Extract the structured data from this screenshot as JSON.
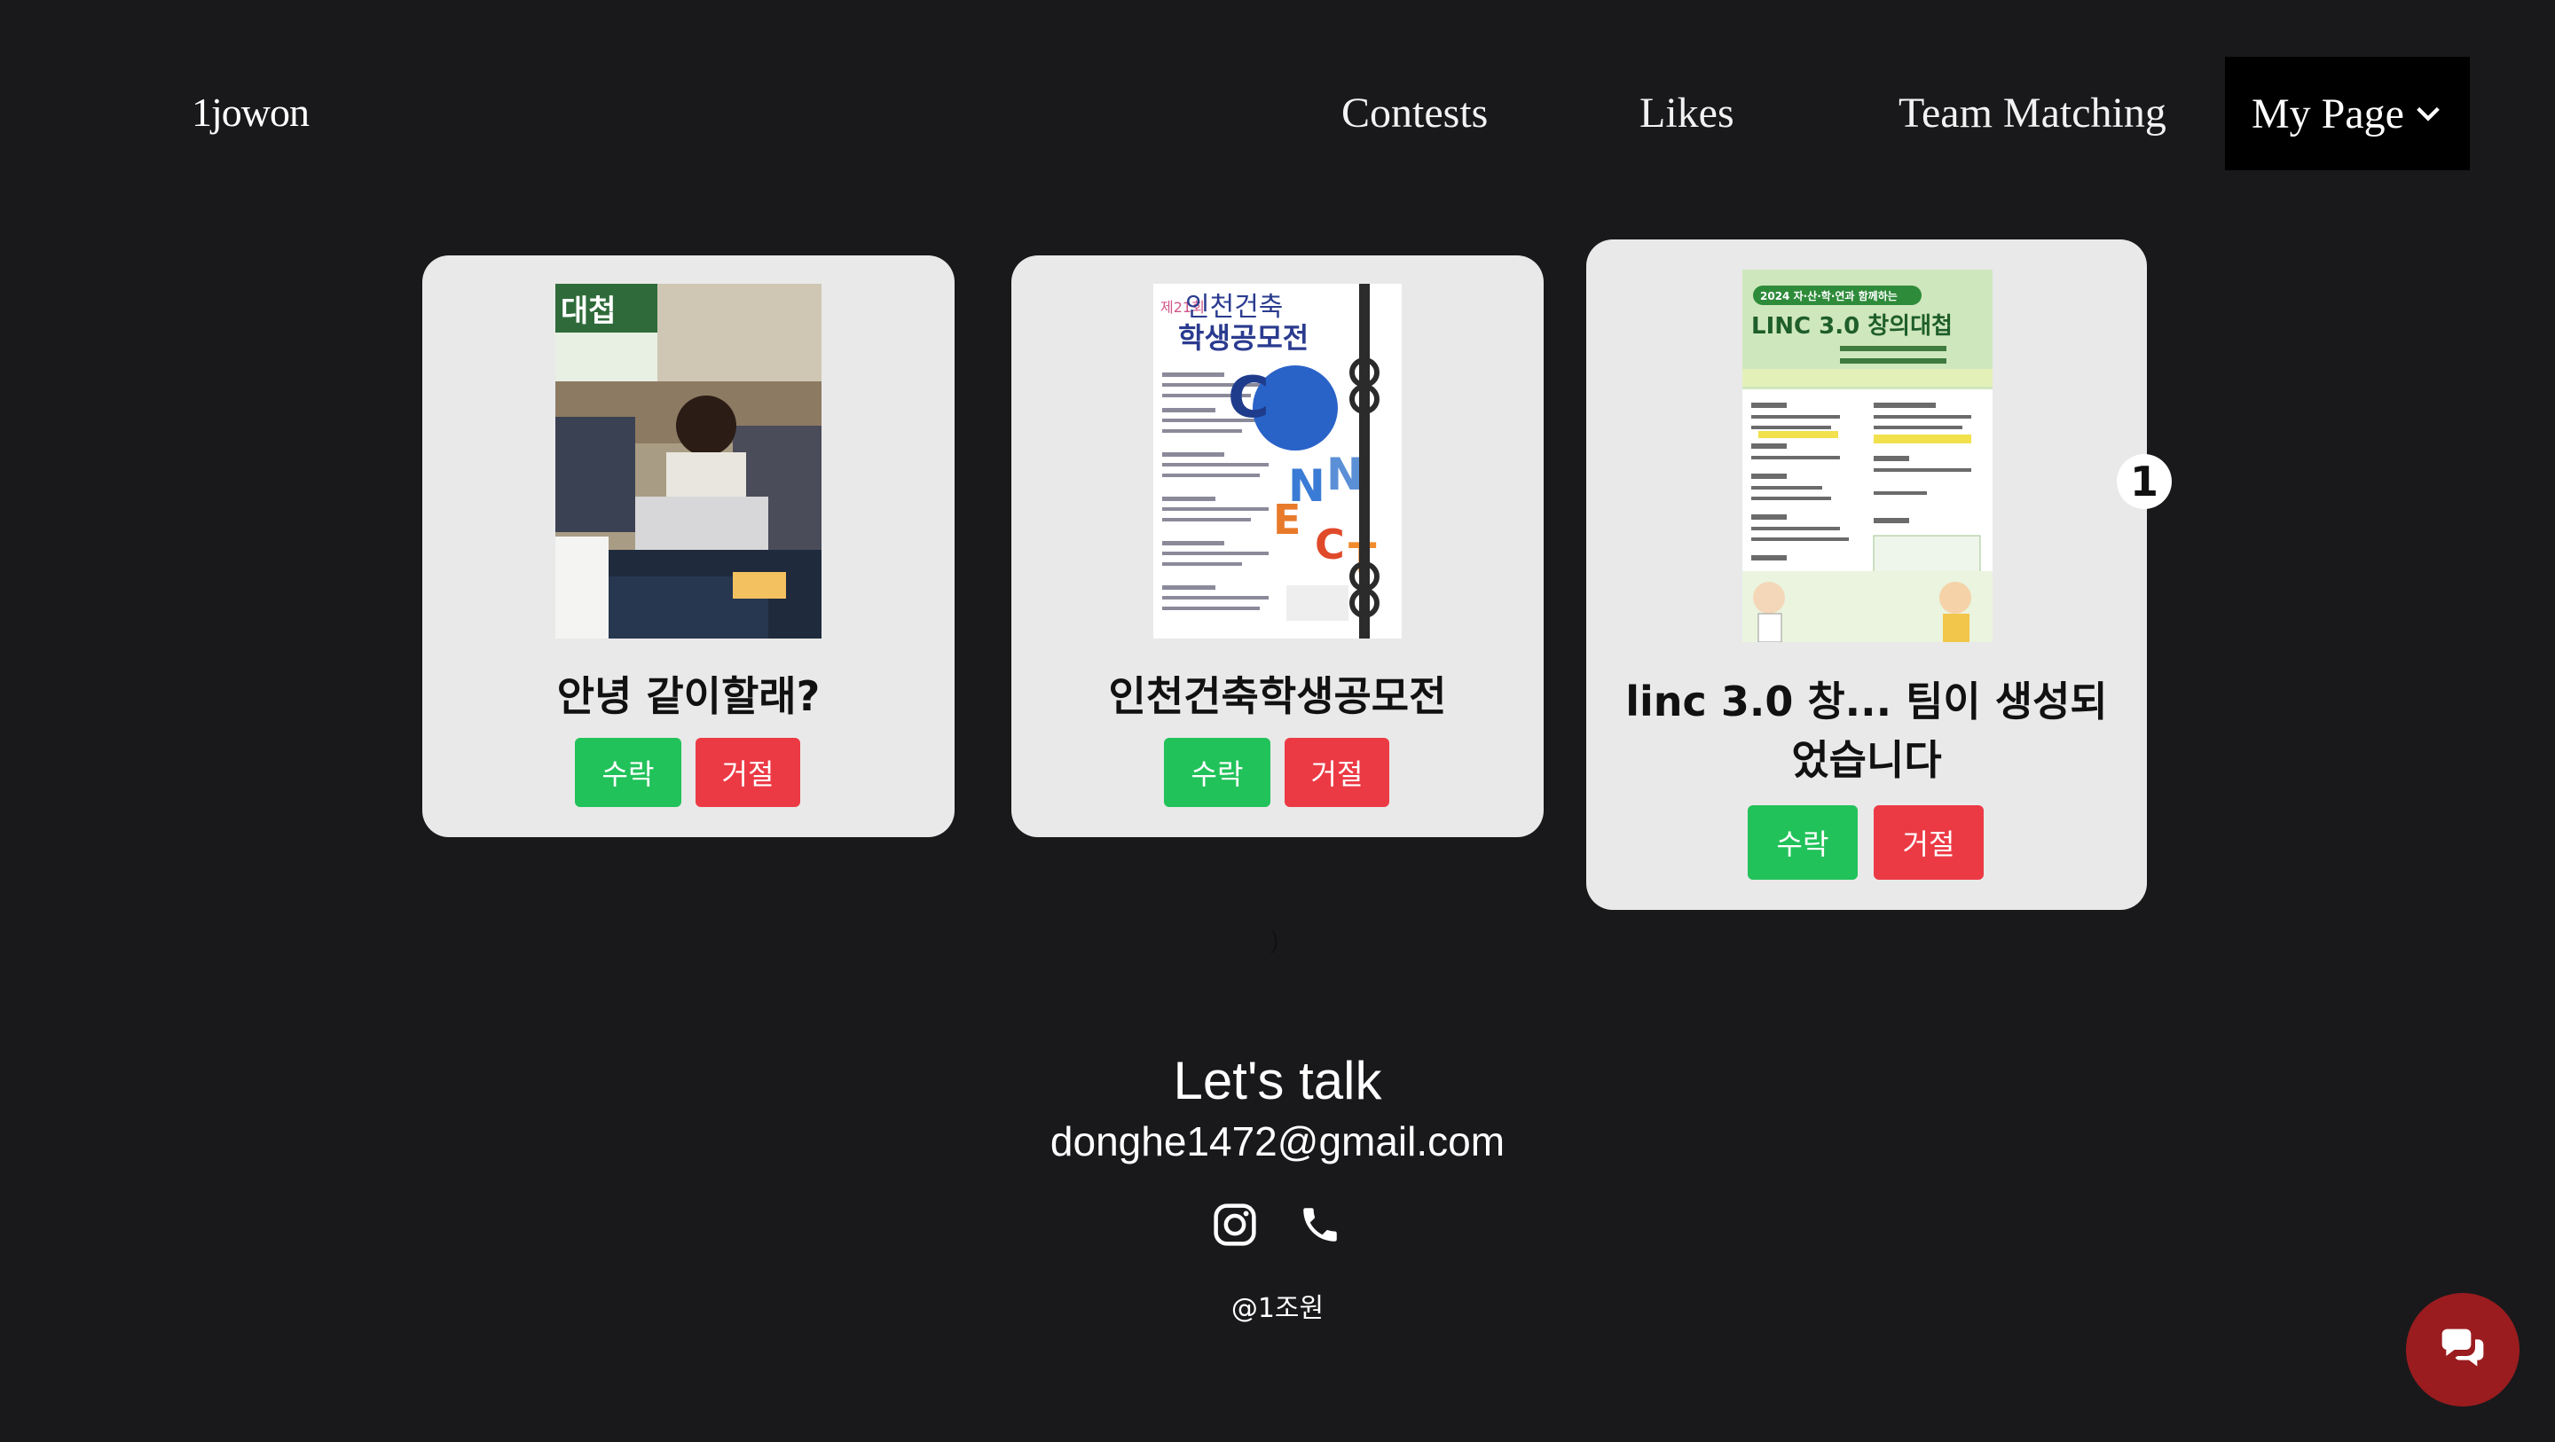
{
  "nav": {
    "brand": "1jowon",
    "contests": "Contests",
    "likes": "Likes",
    "team_matching": "Team Matching",
    "my_page": "My Page"
  },
  "cards": [
    {
      "title": "안녕 같이할래?",
      "accept": "수락",
      "reject": "거절"
    },
    {
      "title": "인천건축학생공모전",
      "accept": "수락",
      "reject": "거절"
    },
    {
      "title": "linc 3.0 창... 팀이 생성되었습니다",
      "accept": "수락",
      "reject": "거절"
    }
  ],
  "poster2": {
    "top": "제21회",
    "line1": "인천건축",
    "line2": "학생공모전",
    "word": "CONNECTS"
  },
  "poster3": {
    "header": "2024 자·산·학·연과 함께하는",
    "title": "LINC 3.0 창의대첩"
  },
  "photo1": {
    "banner": "대첩"
  },
  "notification_count": "1",
  "stray_text": ")",
  "footer": {
    "title": "Let's talk",
    "email": "donghe1472@gmail.com",
    "copyright": "@1조원"
  },
  "icons": {
    "instagram": "instagram-icon",
    "phone": "phone-icon",
    "chat": "chat-icon",
    "chevron": "chevron-down-icon"
  },
  "colors": {
    "background": "#19191b",
    "card": "#e9e9e9",
    "accept": "#22c25a",
    "reject": "#ec3a45",
    "chat_fab": "#9a1c1f"
  }
}
